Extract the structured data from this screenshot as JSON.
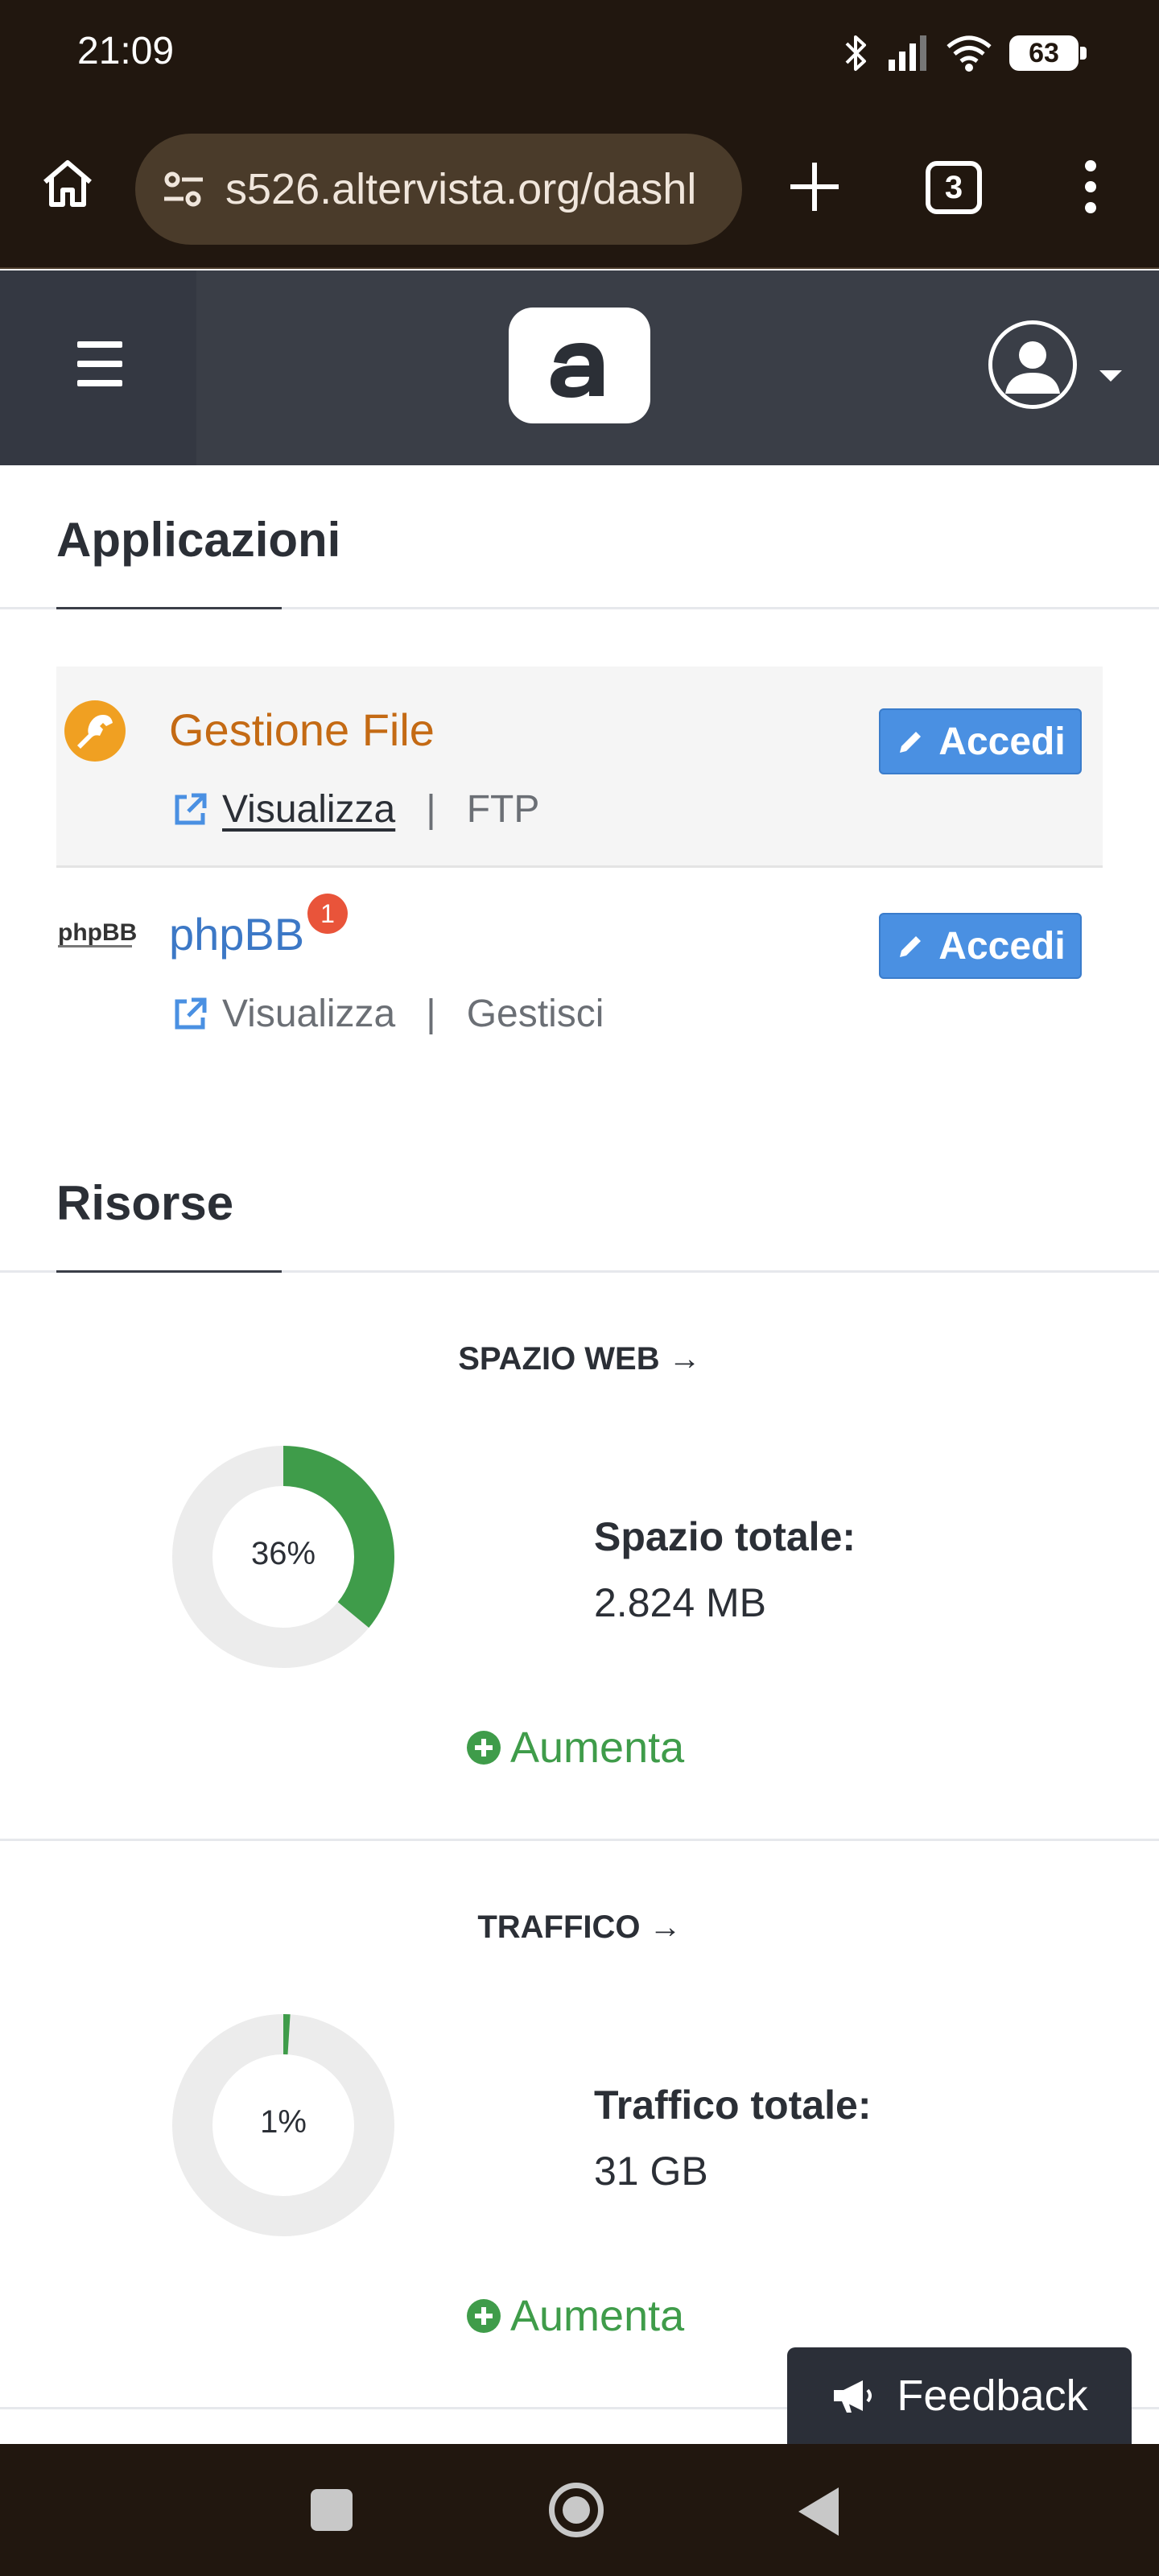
{
  "status_bar": {
    "time": "21:09",
    "battery": "63",
    "icons": [
      "bluetooth-icon",
      "signal-icon",
      "wifi-icon",
      "battery-icon"
    ]
  },
  "browser": {
    "url": "s526.altervista.org/dashl",
    "tab_count": "3"
  },
  "header": {
    "logo_letter": "a",
    "icons": [
      "hamburger-menu-icon",
      "user-avatar-icon",
      "caret-down-icon"
    ]
  },
  "applications": {
    "title": "Applicazioni",
    "items": [
      {
        "name": "Gestione File",
        "icon": "wrench-icon",
        "links": [
          "Visualizza",
          "FTP"
        ],
        "button": "Accedi"
      },
      {
        "name": "phpBB",
        "icon": "phpbb-logo",
        "logo_text": "phpBB",
        "badge": "1",
        "links": [
          "Visualizza",
          "Gestisci"
        ],
        "button": "Accedi"
      }
    ]
  },
  "resources": {
    "title": "Risorse",
    "panels": [
      {
        "title": "SPAZIO WEB →",
        "percent_label": "36%",
        "percent_value": 36,
        "label": "Spazio totale:",
        "value": "2.824 MB",
        "action": "Aumenta"
      },
      {
        "title": "TRAFFICO →",
        "percent_label": "1%",
        "percent_value": 1,
        "label": "Traffico totale:",
        "value": "31 GB",
        "action": "Aumenta"
      }
    ]
  },
  "feedback": {
    "label": "Feedback"
  },
  "colors": {
    "header": "#3a3e47",
    "accent_blue": "#4a90e2",
    "link_orange": "#c46a14",
    "link_blue": "#3c78c6",
    "green": "#3f9c4a",
    "badge_red": "#e9543a",
    "browser_chrome": "#21170f"
  }
}
